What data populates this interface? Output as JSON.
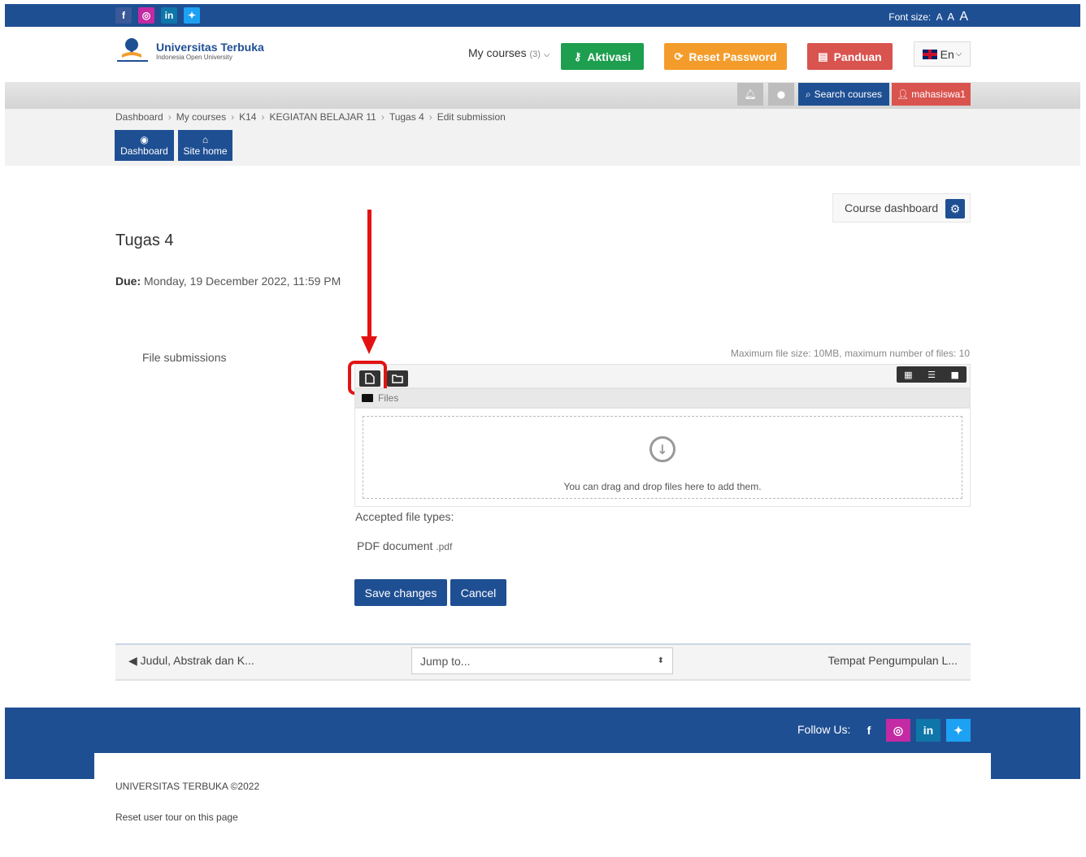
{
  "topbar": {
    "social": [
      {
        "name": "facebook-icon",
        "glyph": "f",
        "color": "#3b5998"
      },
      {
        "name": "instagram-icon",
        "glyph": "◎",
        "color": "#c32aa3"
      },
      {
        "name": "linkedin-icon",
        "glyph": "in",
        "color": "#0e76a8"
      },
      {
        "name": "twitter-icon",
        "glyph": "🐦",
        "color": "#1da1f2"
      }
    ],
    "font_size_label": "Font size:",
    "font_a1": "A",
    "font_a2": "A",
    "font_a3": "A"
  },
  "header": {
    "logo_title": "Universitas Terbuka",
    "logo_sub": "Indonesia Open University",
    "my_courses": "My courses",
    "my_courses_count": "(3)",
    "btn_aktivasi": "Aktivasi",
    "btn_reset": "Reset Password",
    "btn_panduan": "Panduan",
    "lang": "En"
  },
  "navbar": {
    "search": "Search courses",
    "user": "mahasiswa1"
  },
  "breadcrumb": [
    "Dashboard",
    "My courses",
    "K14",
    "KEGIATAN BELAJAR 11",
    "Tugas 4",
    "Edit submission"
  ],
  "quicknav": {
    "dashboard": "Dashboard",
    "sitehome": "Site home"
  },
  "main": {
    "course_dashboard": "Course dashboard",
    "title": "Tugas 4",
    "due_label": "Due:",
    "due_value": "Monday, 19 December 2022, 11:59 PM",
    "file_submissions": "File submissions",
    "max_info": "Maximum file size: 10MB, maximum number of files: 10",
    "path_folder": "Files",
    "drop_text": "You can drag and drop files here to add them.",
    "accepted_label": "Accepted file types:",
    "pdf_label": "PDF document",
    "pdf_ext": ".pdf",
    "save": "Save changes",
    "cancel": "Cancel"
  },
  "activity_nav": {
    "prev": "◀ Judul, Abstrak dan K...",
    "jump": "Jump to...",
    "next": "Tempat Pengumpulan L..."
  },
  "footer": {
    "follow": "Follow Us:",
    "copyright": "UNIVERSITAS TERBUKA ©2022",
    "reset_tour": "Reset user tour on this page"
  },
  "colors": {
    "primary": "#1f4f93",
    "green": "#1e9e4f",
    "orange": "#f39c2b",
    "red": "#d9534f",
    "annotation": "#e31212"
  }
}
